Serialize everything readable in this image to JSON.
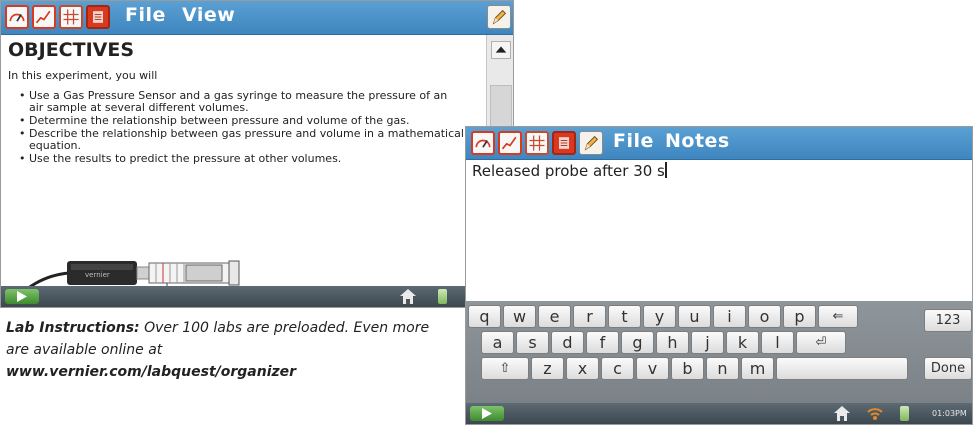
{
  "screen1": {
    "menu": [
      "File",
      "View"
    ],
    "heading": "OBJECTIVES",
    "intro": "In this experiment, you will",
    "objectives": [
      "Use a Gas Pressure Sensor and a gas syringe to measure the pressure of an air sample at several different volumes.",
      "Determine the relationship between pressure and volume of the gas.",
      "Describe the relationship between gas pressure and volume in a mathematical equation.",
      "Use the results to predict the pressure at other volumes."
    ],
    "sensor_brand": "vernier"
  },
  "caption": {
    "lead": "Lab Instructions:",
    "text": " Over 100 labs are preloaded. Even more are available online at",
    "url": "www.vernier.com/labquest/organizer"
  },
  "screen2": {
    "menu": [
      "File",
      "Notes"
    ],
    "note_text": "Released probe after 30 s",
    "keyboard": {
      "row1": [
        "q",
        "w",
        "e",
        "r",
        "t",
        "y",
        "u",
        "i",
        "o",
        "p",
        "⇐"
      ],
      "row2": [
        "a",
        "s",
        "d",
        "f",
        "g",
        "h",
        "j",
        "k",
        "l",
        "⏎"
      ],
      "row3": [
        "⇧",
        "z",
        "x",
        "c",
        "v",
        "b",
        "n",
        "m"
      ],
      "num_key": "123",
      "done_key": "Done"
    },
    "clock": "01:03PM"
  },
  "colors": {
    "titlebar": "#4a92c9",
    "tab_red": "#d8391f",
    "status_bar": "#4a555d",
    "play_green": "#5aa64a"
  }
}
